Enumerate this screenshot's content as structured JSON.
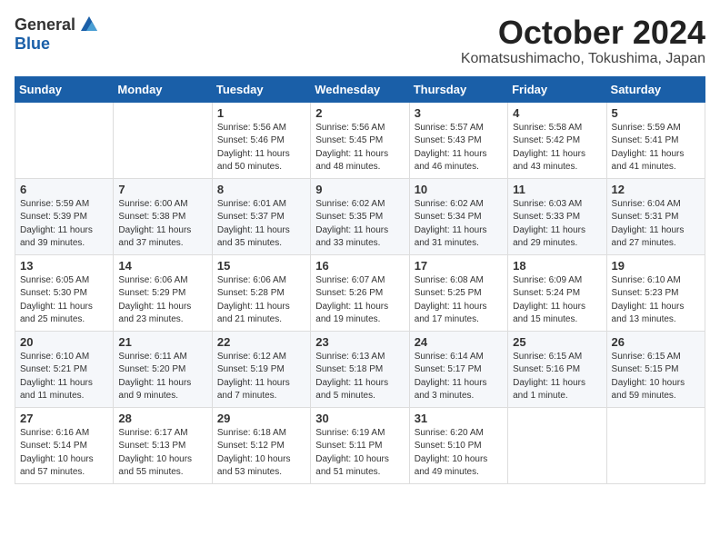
{
  "logo": {
    "general": "General",
    "blue": "Blue"
  },
  "title": "October 2024",
  "location": "Komatsushimacho, Tokushima, Japan",
  "days": [
    "Sunday",
    "Monday",
    "Tuesday",
    "Wednesday",
    "Thursday",
    "Friday",
    "Saturday"
  ],
  "weeks": [
    [
      {
        "day": "",
        "info": ""
      },
      {
        "day": "",
        "info": ""
      },
      {
        "day": "1",
        "info": "Sunrise: 5:56 AM\nSunset: 5:46 PM\nDaylight: 11 hours and 50 minutes."
      },
      {
        "day": "2",
        "info": "Sunrise: 5:56 AM\nSunset: 5:45 PM\nDaylight: 11 hours and 48 minutes."
      },
      {
        "day": "3",
        "info": "Sunrise: 5:57 AM\nSunset: 5:43 PM\nDaylight: 11 hours and 46 minutes."
      },
      {
        "day": "4",
        "info": "Sunrise: 5:58 AM\nSunset: 5:42 PM\nDaylight: 11 hours and 43 minutes."
      },
      {
        "day": "5",
        "info": "Sunrise: 5:59 AM\nSunset: 5:41 PM\nDaylight: 11 hours and 41 minutes."
      }
    ],
    [
      {
        "day": "6",
        "info": "Sunrise: 5:59 AM\nSunset: 5:39 PM\nDaylight: 11 hours and 39 minutes."
      },
      {
        "day": "7",
        "info": "Sunrise: 6:00 AM\nSunset: 5:38 PM\nDaylight: 11 hours and 37 minutes."
      },
      {
        "day": "8",
        "info": "Sunrise: 6:01 AM\nSunset: 5:37 PM\nDaylight: 11 hours and 35 minutes."
      },
      {
        "day": "9",
        "info": "Sunrise: 6:02 AM\nSunset: 5:35 PM\nDaylight: 11 hours and 33 minutes."
      },
      {
        "day": "10",
        "info": "Sunrise: 6:02 AM\nSunset: 5:34 PM\nDaylight: 11 hours and 31 minutes."
      },
      {
        "day": "11",
        "info": "Sunrise: 6:03 AM\nSunset: 5:33 PM\nDaylight: 11 hours and 29 minutes."
      },
      {
        "day": "12",
        "info": "Sunrise: 6:04 AM\nSunset: 5:31 PM\nDaylight: 11 hours and 27 minutes."
      }
    ],
    [
      {
        "day": "13",
        "info": "Sunrise: 6:05 AM\nSunset: 5:30 PM\nDaylight: 11 hours and 25 minutes."
      },
      {
        "day": "14",
        "info": "Sunrise: 6:06 AM\nSunset: 5:29 PM\nDaylight: 11 hours and 23 minutes."
      },
      {
        "day": "15",
        "info": "Sunrise: 6:06 AM\nSunset: 5:28 PM\nDaylight: 11 hours and 21 minutes."
      },
      {
        "day": "16",
        "info": "Sunrise: 6:07 AM\nSunset: 5:26 PM\nDaylight: 11 hours and 19 minutes."
      },
      {
        "day": "17",
        "info": "Sunrise: 6:08 AM\nSunset: 5:25 PM\nDaylight: 11 hours and 17 minutes."
      },
      {
        "day": "18",
        "info": "Sunrise: 6:09 AM\nSunset: 5:24 PM\nDaylight: 11 hours and 15 minutes."
      },
      {
        "day": "19",
        "info": "Sunrise: 6:10 AM\nSunset: 5:23 PM\nDaylight: 11 hours and 13 minutes."
      }
    ],
    [
      {
        "day": "20",
        "info": "Sunrise: 6:10 AM\nSunset: 5:21 PM\nDaylight: 11 hours and 11 minutes."
      },
      {
        "day": "21",
        "info": "Sunrise: 6:11 AM\nSunset: 5:20 PM\nDaylight: 11 hours and 9 minutes."
      },
      {
        "day": "22",
        "info": "Sunrise: 6:12 AM\nSunset: 5:19 PM\nDaylight: 11 hours and 7 minutes."
      },
      {
        "day": "23",
        "info": "Sunrise: 6:13 AM\nSunset: 5:18 PM\nDaylight: 11 hours and 5 minutes."
      },
      {
        "day": "24",
        "info": "Sunrise: 6:14 AM\nSunset: 5:17 PM\nDaylight: 11 hours and 3 minutes."
      },
      {
        "day": "25",
        "info": "Sunrise: 6:15 AM\nSunset: 5:16 PM\nDaylight: 11 hours and 1 minute."
      },
      {
        "day": "26",
        "info": "Sunrise: 6:15 AM\nSunset: 5:15 PM\nDaylight: 10 hours and 59 minutes."
      }
    ],
    [
      {
        "day": "27",
        "info": "Sunrise: 6:16 AM\nSunset: 5:14 PM\nDaylight: 10 hours and 57 minutes."
      },
      {
        "day": "28",
        "info": "Sunrise: 6:17 AM\nSunset: 5:13 PM\nDaylight: 10 hours and 55 minutes."
      },
      {
        "day": "29",
        "info": "Sunrise: 6:18 AM\nSunset: 5:12 PM\nDaylight: 10 hours and 53 minutes."
      },
      {
        "day": "30",
        "info": "Sunrise: 6:19 AM\nSunset: 5:11 PM\nDaylight: 10 hours and 51 minutes."
      },
      {
        "day": "31",
        "info": "Sunrise: 6:20 AM\nSunset: 5:10 PM\nDaylight: 10 hours and 49 minutes."
      },
      {
        "day": "",
        "info": ""
      },
      {
        "day": "",
        "info": ""
      }
    ]
  ]
}
